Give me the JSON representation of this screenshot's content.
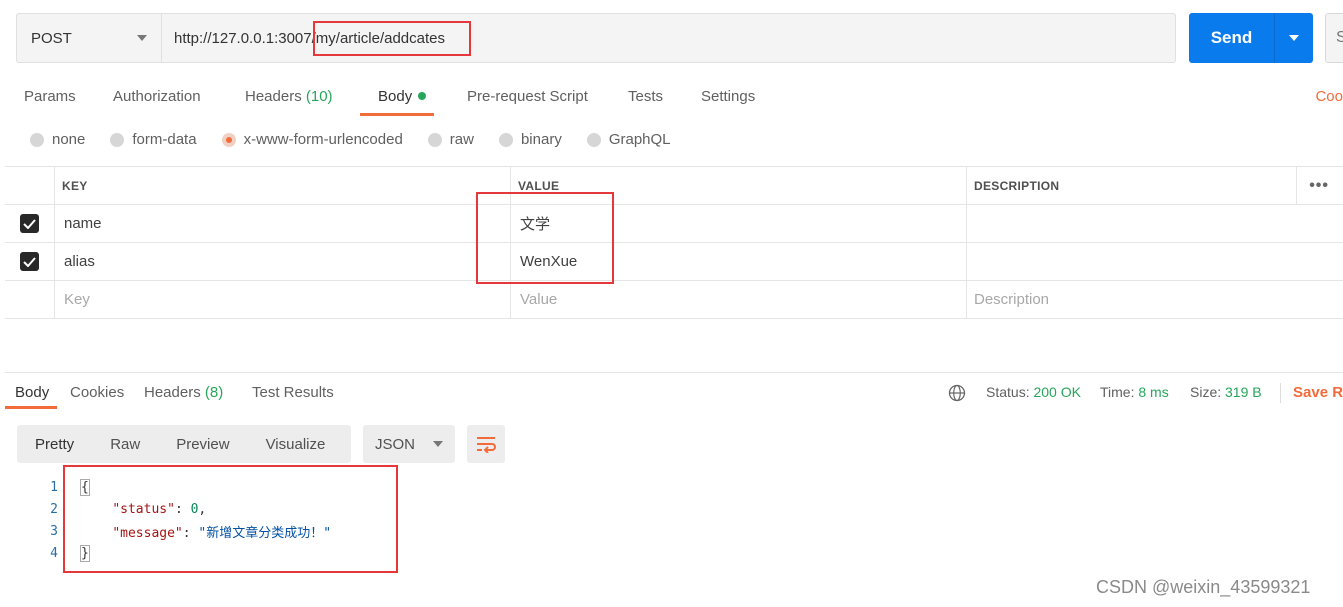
{
  "request": {
    "method": "POST",
    "url": "http://127.0.0.1:3007/my/article/addcates",
    "send_label": "Send",
    "save_stub": "S"
  },
  "request_tabs": {
    "params": "Params",
    "authorization": "Authorization",
    "headers": "Headers",
    "headers_count": "(10)",
    "body": "Body",
    "prerequest": "Pre-request Script",
    "tests": "Tests",
    "settings": "Settings",
    "cookies": "Coo"
  },
  "body_types": [
    "none",
    "form-data",
    "x-www-form-urlencoded",
    "raw",
    "binary",
    "GraphQL"
  ],
  "body_type_selected": "x-www-form-urlencoded",
  "params_table": {
    "headers": {
      "key": "KEY",
      "value": "VALUE",
      "description": "DESCRIPTION"
    },
    "rows": [
      {
        "key": "name",
        "value": "文学",
        "description": "",
        "checked": true
      },
      {
        "key": "alias",
        "value": "WenXue",
        "description": "",
        "checked": true
      }
    ],
    "placeholder": {
      "key": "Key",
      "value": "Value",
      "description": "Description"
    }
  },
  "response": {
    "tabs": {
      "body": "Body",
      "cookies": "Cookies",
      "headers": "Headers",
      "headers_count": "(8)",
      "test_results": "Test Results"
    },
    "status_label": "Status:",
    "status_value": "200 OK",
    "time_label": "Time:",
    "time_value": "8 ms",
    "size_label": "Size:",
    "size_value": "319 B",
    "save_label": "Save Re",
    "view_modes": [
      "Pretty",
      "Raw",
      "Preview",
      "Visualize"
    ],
    "format": "JSON",
    "code": {
      "line_numbers": [
        "1",
        "2",
        "3",
        "4"
      ],
      "open_brace": "{",
      "status_key": "\"status\"",
      "status_value": "0",
      "message_key": "\"message\"",
      "message_value": "\"新增文章分类成功！\"",
      "close_brace": "}"
    }
  },
  "watermark": "CSDN @weixin_43599321",
  "colors": {
    "accent": "#f26b3a",
    "send": "#097bed",
    "success": "#26a65b",
    "annotation": "#e5383b"
  }
}
